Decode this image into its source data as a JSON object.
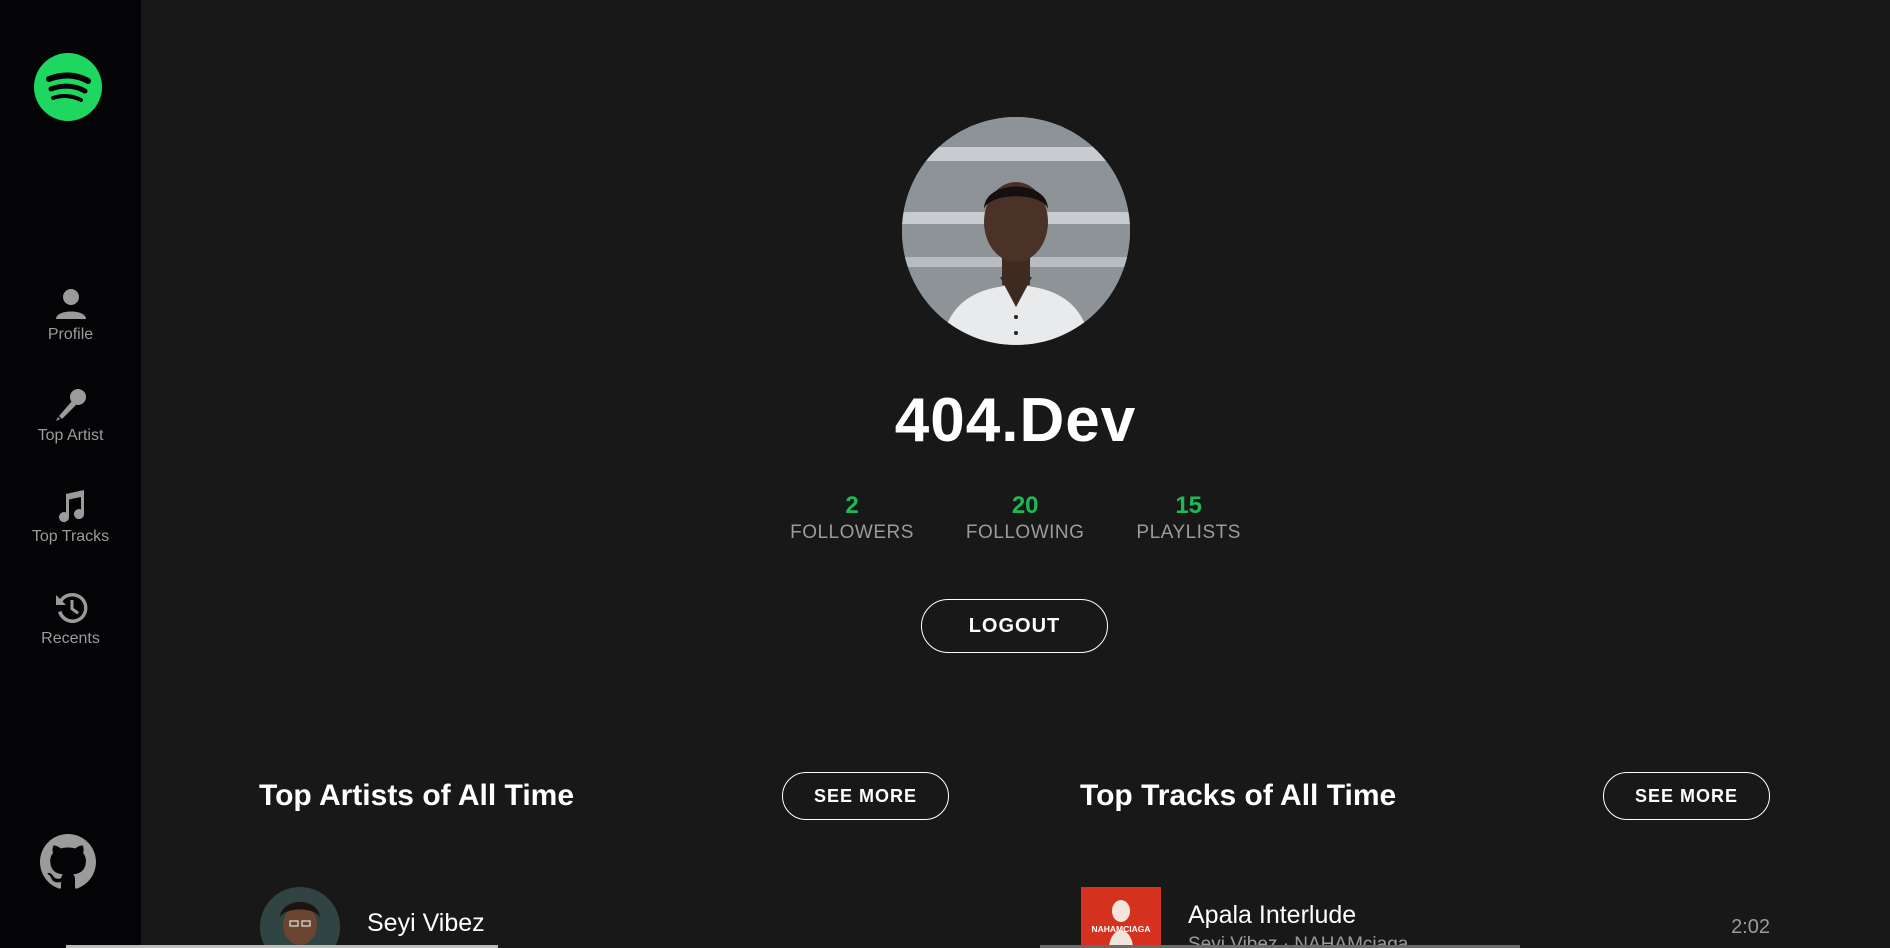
{
  "sidebar": {
    "logo": "spotify-logo",
    "items": [
      {
        "label": "Profile",
        "icon": "user-icon"
      },
      {
        "label": "Top Artist",
        "icon": "microphone-icon"
      },
      {
        "label": "Top Tracks",
        "icon": "music-note-icon"
      },
      {
        "label": "Recents",
        "icon": "history-icon"
      }
    ],
    "github_icon": "github-icon"
  },
  "profile": {
    "username": "404.Dev",
    "stats": [
      {
        "value": "2",
        "label": "FOLLOWERS"
      },
      {
        "value": "20",
        "label": "FOLLOWING"
      },
      {
        "value": "15",
        "label": "PLAYLISTS"
      }
    ],
    "logout_label": "LOGOUT"
  },
  "top_artists": {
    "title": "Top Artists of All Time",
    "see_more_label": "SEE MORE",
    "items": [
      {
        "name": "Seyi Vibez"
      }
    ]
  },
  "top_tracks": {
    "title": "Top Tracks of All Time",
    "see_more_label": "SEE MORE",
    "items": [
      {
        "name": "Apala Interlude",
        "artists": "Seyi Vibez · NAHAMciaga",
        "duration": "2:02",
        "album_art_text": "NAHAMCIAGA"
      }
    ]
  },
  "colors": {
    "accent": "#1db954",
    "sidebar_bg": "#040306",
    "main_bg": "#181818",
    "muted_text": "#9b9b9b"
  }
}
